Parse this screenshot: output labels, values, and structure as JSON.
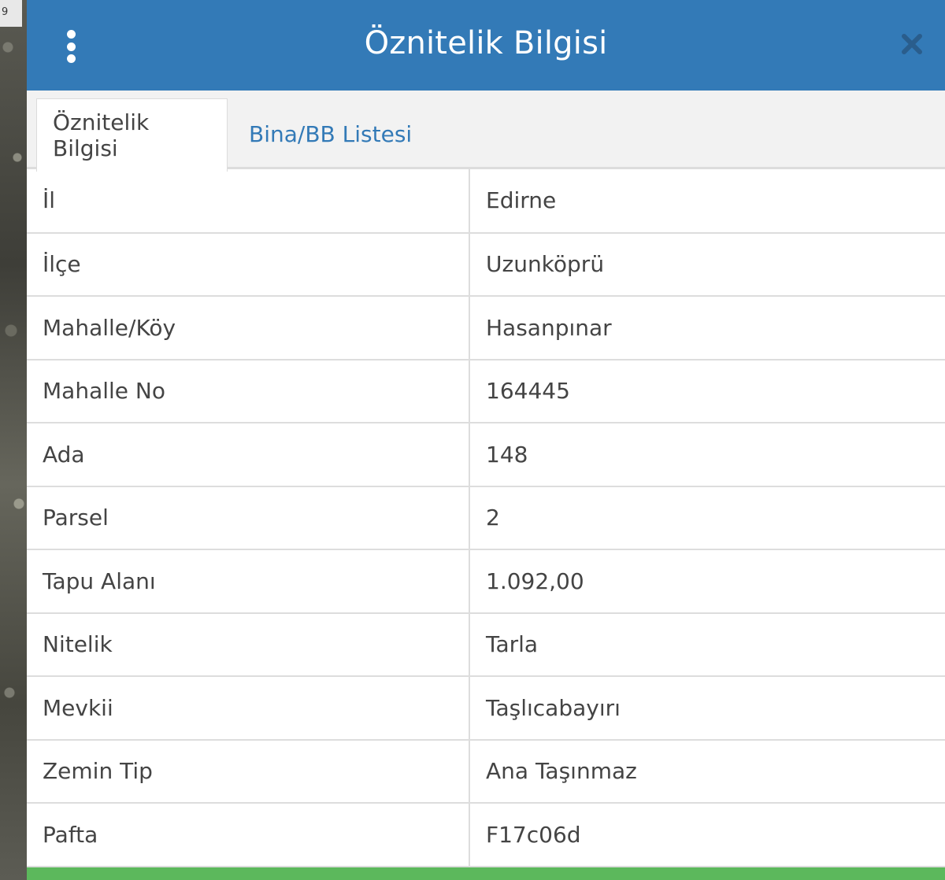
{
  "map": {
    "corner_label": "9"
  },
  "header": {
    "title": "Öznitelik Bilgisi",
    "menu_icon": "vertical-dots-icon",
    "close_icon": "close-icon",
    "background": "#337ab7"
  },
  "tabs": [
    {
      "label": "Öznitelik Bilgisi",
      "active": true
    },
    {
      "label": "Bina/BB Listesi",
      "active": false
    }
  ],
  "attributes": [
    {
      "key": "İl",
      "value": "Edirne"
    },
    {
      "key": "İlçe",
      "value": "Uzunköprü"
    },
    {
      "key": "Mahalle/Köy",
      "value": "Hasanpınar"
    },
    {
      "key": "Mahalle No",
      "value": "164445"
    },
    {
      "key": "Ada",
      "value": "148"
    },
    {
      "key": "Parsel",
      "value": "2"
    },
    {
      "key": "Tapu Alanı",
      "value": "1.092,00"
    },
    {
      "key": "Nitelik",
      "value": "Tarla"
    },
    {
      "key": "Mevkii",
      "value": "Taşlıcabayırı"
    },
    {
      "key": "Zemin Tip",
      "value": "Ana Taşınmaz"
    },
    {
      "key": "Pafta",
      "value": "F17c06d"
    }
  ],
  "colors": {
    "accent": "#337ab7",
    "footer_bar": "#5cb85c"
  }
}
